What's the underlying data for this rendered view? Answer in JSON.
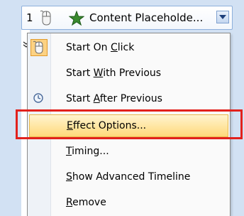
{
  "selector": {
    "order_number": "1",
    "effect_name": "Content Placeholde...",
    "mouse_icon": "mouse-icon",
    "effect_icon": "star-effect-icon",
    "dropdown_icon": "chevron-down-icon"
  },
  "menu": {
    "items": [
      {
        "label": "Start On Click",
        "mnemonic": "C",
        "icon": "mouse-icon",
        "checked": true
      },
      {
        "label": "Start With Previous",
        "mnemonic": "W"
      },
      {
        "label": "Start After Previous",
        "mnemonic": "A",
        "icon": "clock-icon"
      },
      {
        "label": "Effect Options...",
        "mnemonic": "E",
        "highlighted": true
      },
      {
        "label": "Timing...",
        "mnemonic": "T"
      },
      {
        "label": "Show Advanced Timeline",
        "mnemonic": "S"
      },
      {
        "label": "Remove",
        "mnemonic": "R"
      }
    ]
  },
  "colors": {
    "highlight": "#ffd97a",
    "callout_frame": "#e2211c",
    "pane_background": "#d2e1f3"
  }
}
